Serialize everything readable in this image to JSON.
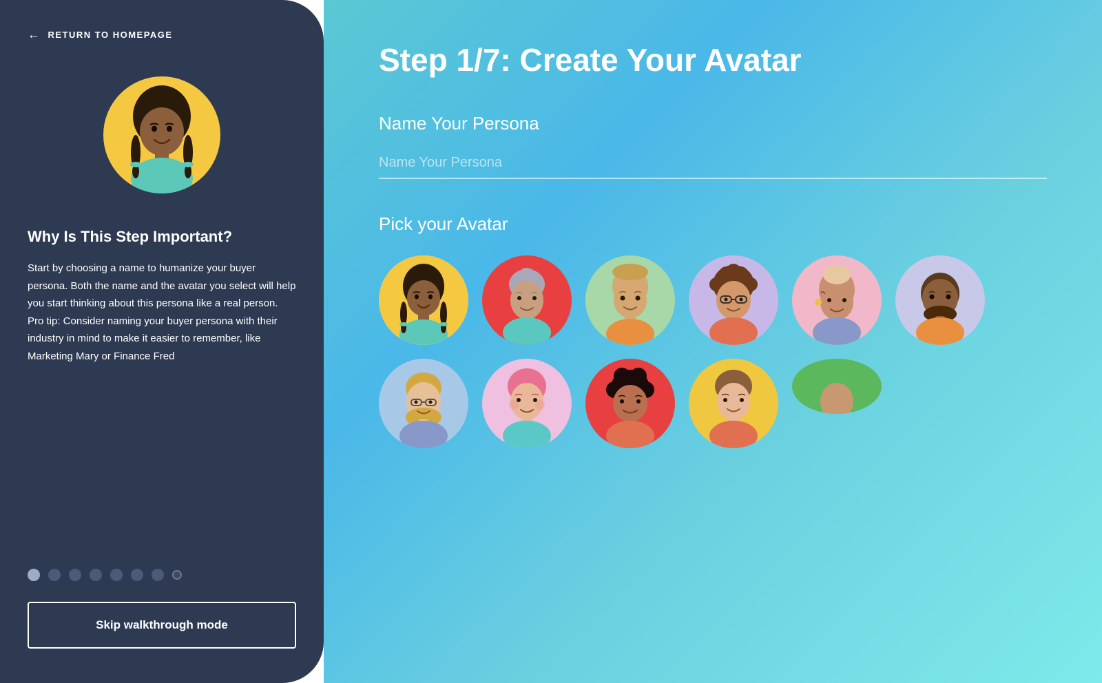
{
  "left_panel": {
    "return_label": "RETURN TO HOMEPAGE",
    "why_title": "Why Is This Step Important?",
    "why_body": "Start by choosing a name to humanize your buyer persona. Both the name and the avatar you select will help you start thinking about this persona like a real person. Pro tip: Consider naming your buyer persona with their industry in mind to make it easier to remember, like Marketing Mary or Finance Fred",
    "skip_label": "Skip walkthrough mode",
    "progress_steps": 8,
    "active_step": 0
  },
  "right_panel": {
    "step_title": "Step 1/7: Create Your Avatar",
    "persona_section_label": "Name Your Persona",
    "persona_placeholder": "Name Your Persona",
    "avatar_section_label": "Pick your Avatar",
    "avatars": [
      {
        "id": 1,
        "bg": "#F5C842",
        "selected": true
      },
      {
        "id": 2,
        "bg": "#e84040"
      },
      {
        "id": 3,
        "bg": "#a8d8a8"
      },
      {
        "id": 4,
        "bg": "#c8b8e8"
      },
      {
        "id": 5,
        "bg": "#f0b8c8"
      },
      {
        "id": 6,
        "bg": "#c8c8e8"
      },
      {
        "id": 7,
        "bg": "#e87830"
      },
      {
        "id": 8,
        "bg": "#a8c8e8"
      },
      {
        "id": 9,
        "bg": "#f0c0e0"
      },
      {
        "id": 10,
        "bg": "#e84040"
      },
      {
        "id": 11,
        "bg": "#f0c840"
      }
    ]
  },
  "colors": {
    "left_bg": "#2d3a52",
    "right_gradient_start": "#5bc8d4",
    "right_gradient_end": "#7eeaea",
    "white": "#ffffff",
    "accent_yellow": "#F5C842"
  }
}
